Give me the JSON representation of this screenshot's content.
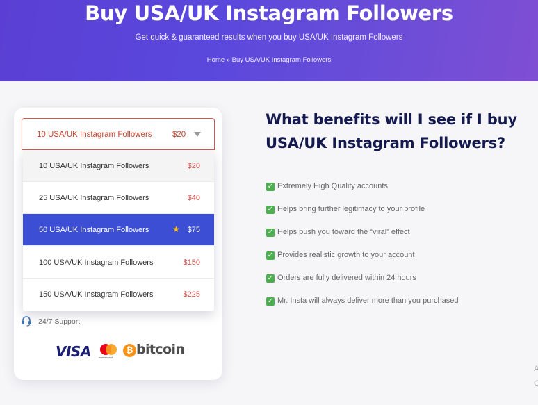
{
  "hero": {
    "title": "Buy USA/UK Instagram Followers",
    "subtitle": "Get quick & guaranteed results when you buy USA/UK Instagram Followers",
    "breadcrumb": "Home » Buy USA/UK Instagram Followers"
  },
  "package_select": {
    "selected_label": "10 USA/UK Instagram Followers",
    "selected_price": "$20",
    "options": [
      {
        "label": "10 USA/UK Instagram Followers",
        "price": "$20"
      },
      {
        "label": "25 USA/UK Instagram Followers",
        "price": "$40"
      },
      {
        "label": "50 USA/UK Instagram Followers",
        "price": "$75",
        "icon": "star-icon"
      },
      {
        "label": "100 USA/UK Instagram Followers",
        "price": "$150"
      },
      {
        "label": "150 USA/UK Instagram Followers",
        "price": "$225"
      }
    ]
  },
  "support": {
    "label": "24/7 Support",
    "icon": "headset-icon"
  },
  "payments": {
    "visa": "VISA",
    "mastercard_text": "mastercard",
    "bitcoin_symbol": "₿",
    "bitcoin_word": "bitcoin"
  },
  "benefits": {
    "title": "What benefits will I see if I buy USA/UK Instagram Followers?",
    "items": [
      "Extremely High Quality accounts",
      "Helps bring further legitimacy to your profile",
      "Helps push you toward the “viral” effect",
      "Provides realistic growth to your account",
      "Orders are fully delivered within 24 hours",
      "Mr. Insta will always deliver more than you purchased"
    ]
  },
  "edge_glyphs": [
    "A",
    "C"
  ],
  "colors": {
    "hero_gradient_start": "#5b3fd4",
    "hero_gradient_end": "#7f4ed3",
    "selected_option": "#3c4fd4",
    "price_red": "#d9534f",
    "check_green": "#4caf50",
    "heading_navy": "#141a4e"
  }
}
